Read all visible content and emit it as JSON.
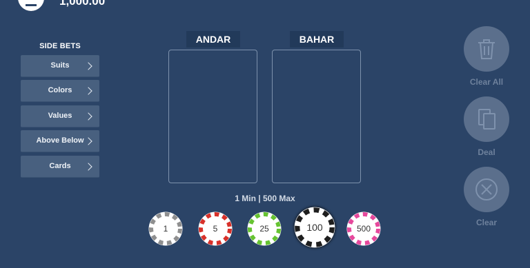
{
  "header": {
    "balance": "1,000.00"
  },
  "side_bets": {
    "title": "SIDE BETS",
    "items": [
      {
        "label": "Suits"
      },
      {
        "label": "Colors"
      },
      {
        "label": "Values"
      },
      {
        "label": "Above Below"
      },
      {
        "label": "Cards"
      }
    ]
  },
  "table": {
    "andar": {
      "label": "ANDAR"
    },
    "bahar": {
      "label": "BAHAR"
    },
    "limits": "1 Min | 500 Max"
  },
  "chips": [
    {
      "value": "1",
      "color": "#8f8f8f",
      "selected": false
    },
    {
      "value": "5",
      "color": "#d8312a",
      "selected": false
    },
    {
      "value": "25",
      "color": "#66c331",
      "selected": false
    },
    {
      "value": "100",
      "color": "#1e1e1e",
      "selected": true
    },
    {
      "value": "500",
      "color": "#e6489c",
      "selected": false
    }
  ],
  "actions": {
    "clear_all": {
      "label": "Clear All",
      "icon": "trash-icon"
    },
    "deal": {
      "label": "Deal",
      "icon": "cards-icon"
    },
    "clear": {
      "label": "Clear",
      "icon": "clear-circle-icon"
    }
  }
}
